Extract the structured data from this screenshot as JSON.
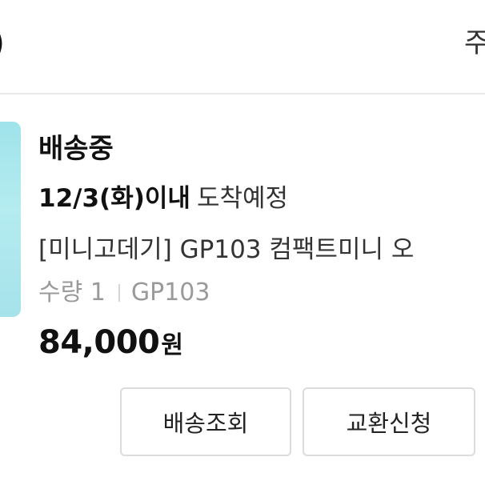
{
  "header": {
    "left_fragment": "))",
    "right_fragment": "주"
  },
  "order": {
    "status": "배송중",
    "delivery_date": "12/3(화)이내",
    "delivery_suffix": "도착예정",
    "product_name": "[미니고데기] GP103 컴팩트미니 오",
    "quantity": "수량 1",
    "option": "GP103",
    "price_amount": "84,000",
    "price_unit": "원"
  },
  "actions": {
    "track_label": "배송조회",
    "exchange_label": "교환신청"
  },
  "colors": {
    "thumbnail": "#a6e2ea",
    "divider": "#e9e9e9",
    "button_border": "#dcdcdc",
    "meta_text": "#9a9a9a"
  },
  "icons": [
    "thumbnail-image"
  ]
}
